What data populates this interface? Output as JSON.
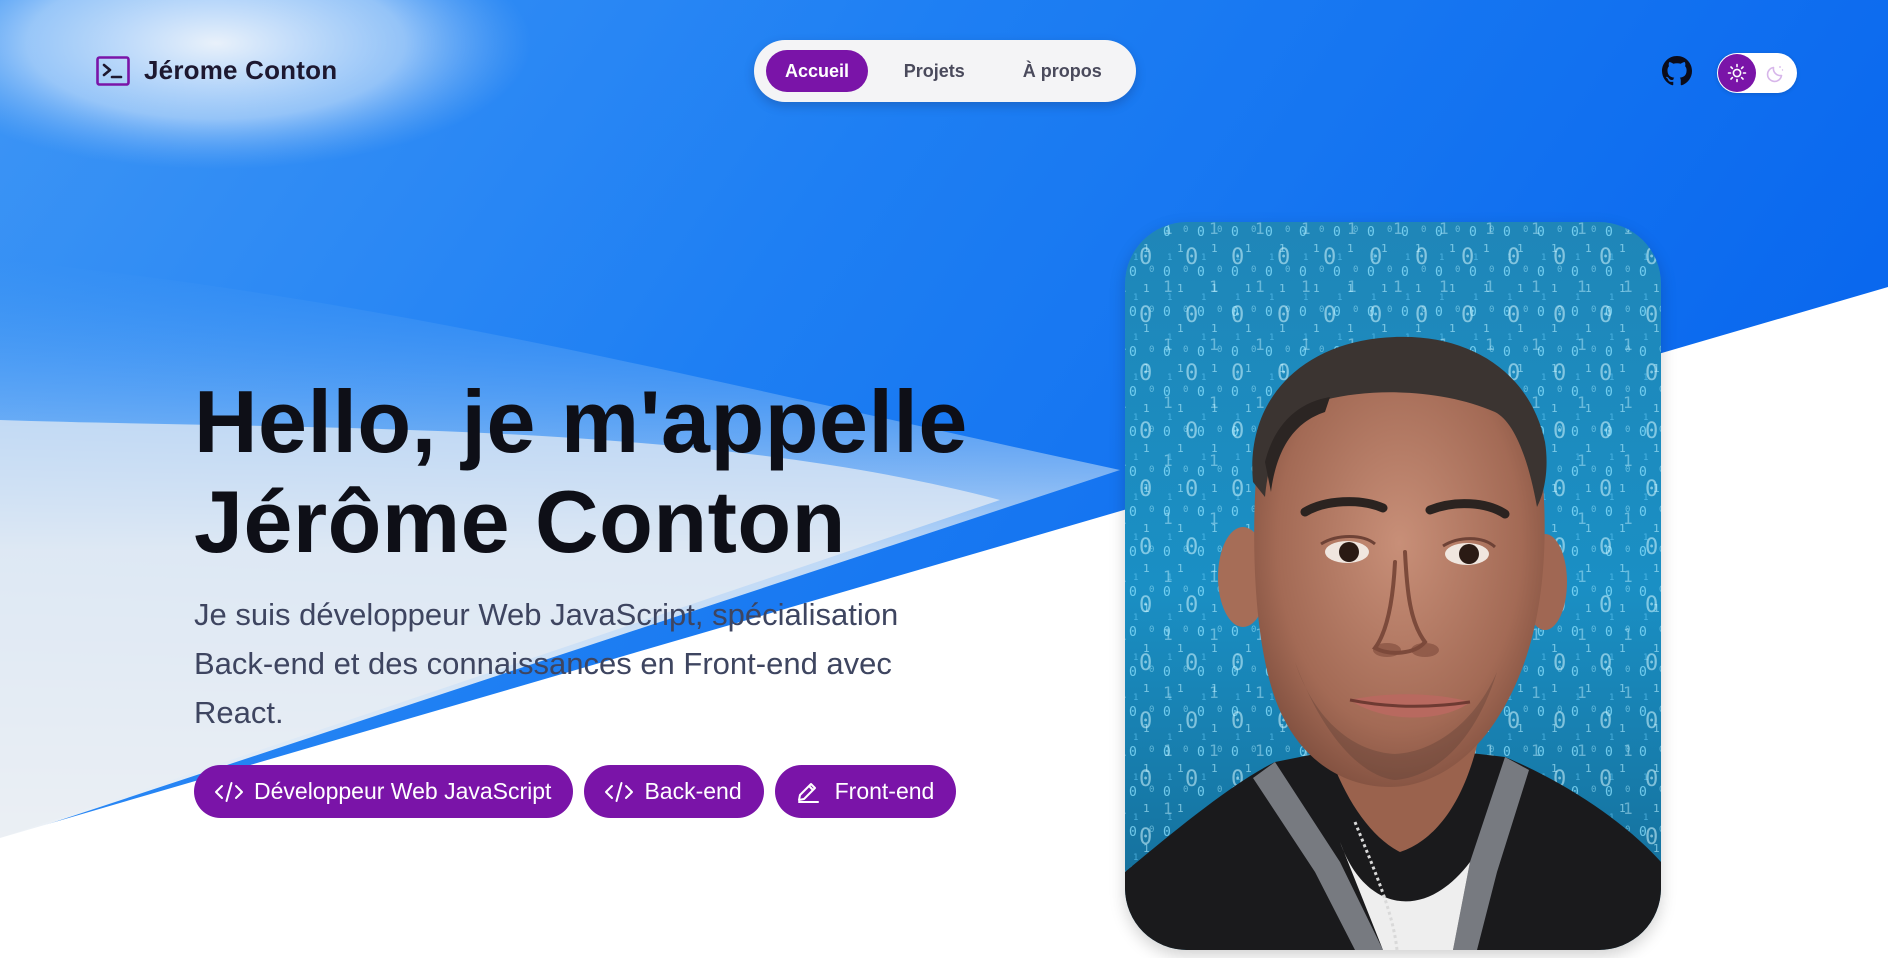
{
  "brand": {
    "name": "Jérome Conton",
    "icon": "terminal-icon"
  },
  "nav": {
    "items": [
      {
        "label": "Accueil",
        "active": true
      },
      {
        "label": "Projets",
        "active": false
      },
      {
        "label": "À propos",
        "active": false
      }
    ]
  },
  "header_actions": {
    "github_icon": "github-icon",
    "theme_toggle": {
      "light_icon": "sun-icon",
      "dark_icon": "moon-icon",
      "mode": "light"
    }
  },
  "hero": {
    "title_line1": "Hello, je m'appelle",
    "title_line2": "Jérôme Conton",
    "subtitle": "Je suis développeur Web JavaScript, spécialisation Back-end et des connaissances en Front-end avec React.",
    "tags": [
      {
        "label": "Développeur Web JavaScript",
        "icon": "code-icon"
      },
      {
        "label": "Back-end",
        "icon": "code-icon"
      },
      {
        "label": "Front-end",
        "icon": "pencil-icon"
      }
    ]
  },
  "portrait": {
    "alt": "portrait photo over binary code background"
  },
  "colors": {
    "accent": "#7a14a8",
    "sky": "#1f7af0",
    "title": "#0e0f17",
    "subtitle": "#3e4560"
  }
}
